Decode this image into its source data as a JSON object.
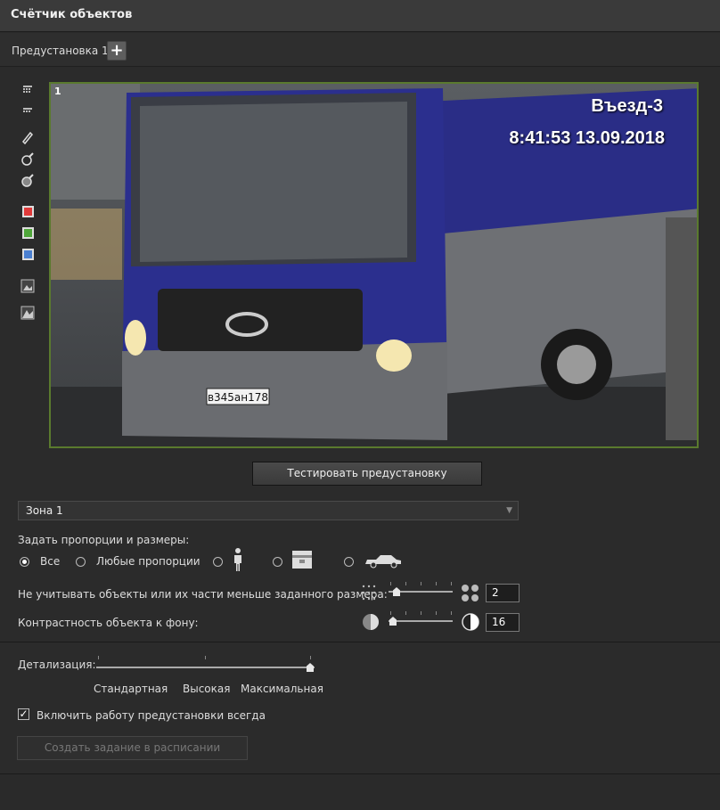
{
  "window": {
    "title": "Счётчик объектов"
  },
  "presets": {
    "tab_label": "Предустановка 1",
    "add_icon": "plus-icon"
  },
  "toolbar": {
    "icons": [
      "grid-icon",
      "grid-small-icon",
      "pen-icon",
      "pen-plus-icon",
      "pen-minus-icon",
      "red-zone-icon",
      "green-zone-icon",
      "blue-zone-icon",
      "image-small-icon",
      "image-large-icon"
    ],
    "colors": {
      "red": "#e03a3a",
      "green": "#4fa63a",
      "blue": "#4a7fd0"
    }
  },
  "video": {
    "camera_number": "1",
    "osd_name": "Въезд-3",
    "osd_datetime": "8:41:53  13.09.2018",
    "plate": "в345ан178",
    "border_color": "#5a7a2e"
  },
  "test_button": {
    "label": "Тестировать предустановку"
  },
  "zone_select": {
    "value": "Зона 1"
  },
  "proportions": {
    "label": "Задать пропорции и размеры:",
    "options": [
      {
        "label": "Все",
        "selected": true
      },
      {
        "label": "Любые пропорции",
        "selected": false
      },
      {
        "label": "",
        "icon": "person-icon",
        "selected": false
      },
      {
        "label": "",
        "icon": "box-icon",
        "selected": false
      },
      {
        "label": "",
        "icon": "car-icon",
        "selected": false
      }
    ]
  },
  "min_size": {
    "label": "Не учитывать объекты или их части меньше заданного размера:",
    "value": "2",
    "min_icon": "dots-small-icon",
    "max_icon": "dots-large-icon",
    "slider_fraction": 0.1
  },
  "contrast": {
    "label": "Контрастность объекта к фону:",
    "value": "16",
    "min_icon": "contrast-low-icon",
    "max_icon": "contrast-high-icon",
    "slider_fraction": 0.05
  },
  "detail": {
    "label": "Детализация:",
    "levels": [
      "Стандартная",
      "Высокая",
      "Максимальная"
    ],
    "selected_index": 2
  },
  "always_on": {
    "label": "Включить работу предустановки всегда",
    "checked": true
  },
  "schedule_button": {
    "label": "Создать задание в расписании"
  }
}
